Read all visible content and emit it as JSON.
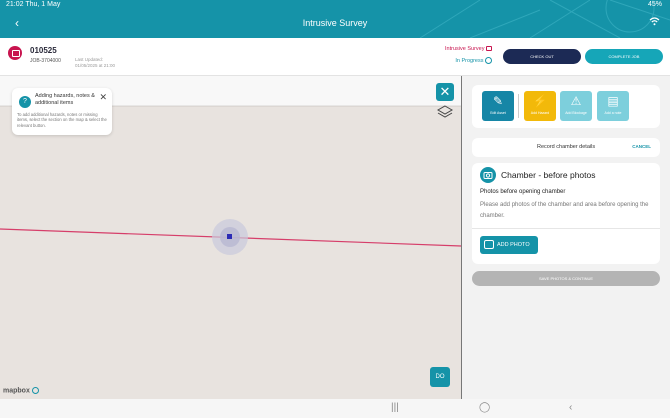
{
  "status": {
    "time": "21:02",
    "date": "Thu, 1 May",
    "battery": "45%"
  },
  "appbar": {
    "title": "Intrusive Survey",
    "back_icon": "chevron-left-icon",
    "wifi_icon": "wifi-icon"
  },
  "job": {
    "number": "010525",
    "id": "JOB-3704000",
    "last_updated_label": "Last Updated:",
    "last_updated_value": "01/05/2025 at 21:00",
    "survey_type": "Intrusive Survey",
    "status": "In Progress",
    "check_out_label": "CHECK OUT",
    "complete_label": "COMPLETE JOB"
  },
  "map": {
    "tip_title": "Adding hazards, notes & additional items",
    "tip_body": "To add additional hazards, notes or missing items, select the section on the map & select the relevant button.",
    "map_button_label": "DO",
    "attribution": "mapbox"
  },
  "tools": [
    {
      "label": "Edit Asset",
      "icon": "pencil-icon"
    },
    {
      "label": "Add Hazard",
      "icon": "lightning-icon"
    },
    {
      "label": "Add Blockage",
      "icon": "warning-icon"
    },
    {
      "label": "Add a note",
      "icon": "note-icon"
    }
  ],
  "record": {
    "label": "Record chamber details",
    "cancel": "CANCEL"
  },
  "chamber": {
    "heading": "Chamber - before photos",
    "subheading": "Photos before opening chamber",
    "description": "Please add photos of the chamber and area before opening the chamber.",
    "add_photo_label": "ADD PHOTO"
  },
  "save_label": "SAVE PHOTOS & CONTINUE",
  "colors": {
    "primary": "#1593a8",
    "navy": "#1c2a55",
    "hazard": "#f2b90a",
    "alert": "#c8144f",
    "line": "#d63e6a"
  }
}
